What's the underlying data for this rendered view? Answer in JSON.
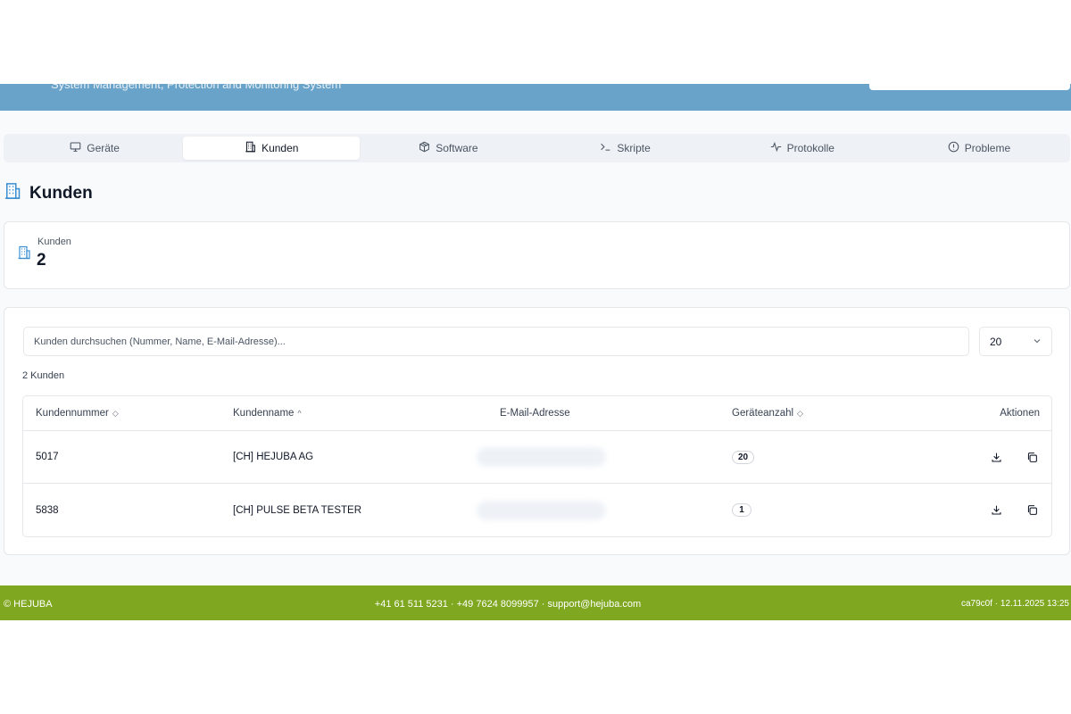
{
  "header": {
    "subtitle": "System Management, Protection and Monitoring System"
  },
  "tabs": [
    {
      "label": "Geräte",
      "icon": "monitor-icon",
      "active": false
    },
    {
      "label": "Kunden",
      "icon": "building-icon",
      "active": true
    },
    {
      "label": "Software",
      "icon": "package-icon",
      "active": false
    },
    {
      "label": "Skripte",
      "icon": "terminal-icon",
      "active": false
    },
    {
      "label": "Protokolle",
      "icon": "activity-icon",
      "active": false
    },
    {
      "label": "Probleme",
      "icon": "alert-circle-icon",
      "active": false
    }
  ],
  "page": {
    "title": "Kunden"
  },
  "stat": {
    "label": "Kunden",
    "value": "2"
  },
  "list": {
    "search_placeholder": "Kunden durchsuchen (Nummer, Name, E-Mail-Adresse)...",
    "page_size": "20",
    "count_text": "2 Kunden",
    "columns": {
      "number": "Kundennummer",
      "name": "Kundenname",
      "email": "E-Mail-Adresse",
      "devices": "Geräteanzahl",
      "actions": "Aktionen"
    },
    "sort_icons": {
      "number": "◇",
      "name": "^",
      "devices": "◇"
    },
    "rows": [
      {
        "number": "5017",
        "name": "[CH] HEJUBA AG",
        "devices": "20"
      },
      {
        "number": "5838",
        "name": "[CH] PULSE BETA TESTER",
        "devices": "1"
      }
    ]
  },
  "footer": {
    "copyright": "© HEJUBA",
    "contact": "+41 61 511 5231  ·  +49 7624 8099957  ·  support@hejuba.com",
    "build": "ca79c0f · 12.11.2025 13:25"
  },
  "colors": {
    "banner": "#6aa3c9",
    "footer": "#7fa720",
    "accent_icon": "#3b8fd1"
  }
}
